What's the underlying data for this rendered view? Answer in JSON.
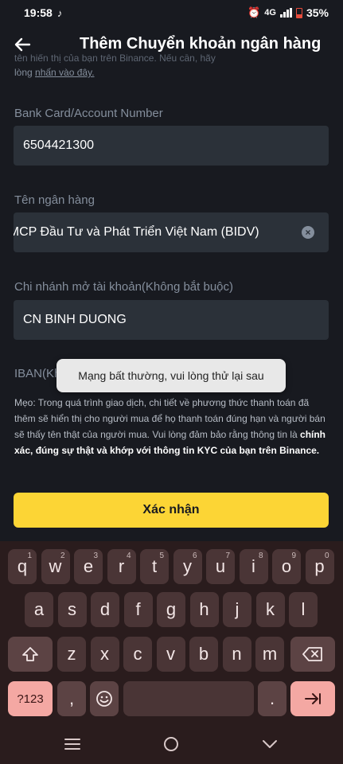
{
  "status": {
    "time": "19:58",
    "network": "4G",
    "battery": "35%"
  },
  "header": {
    "title": "Thêm Chuyển khoản ngân hàng"
  },
  "note_top": {
    "line1": "tên hiển thị của bạn trên Binance. Nếu cần, hãy",
    "line2_prefix": "lòng ",
    "line2_link": "nhấn vào đây."
  },
  "fields": {
    "account": {
      "label": "Bank Card/Account Number",
      "value": "6504421300"
    },
    "bank": {
      "label": "Tên ngân hàng",
      "value": "TMCP Đầu Tư và Phát Triển Việt Nam (BIDV)"
    },
    "branch": {
      "label": "Chi nhánh mở tài khoản(Không bắt buộc)",
      "value": "CN BINH DUONG"
    },
    "iban": {
      "label": "IBAN(Không bắt buộc)"
    }
  },
  "toast": "Mạng bất thường, vui lòng thử lại sau",
  "tip": {
    "text": "Mẹo: Trong quá trình giao dịch, chi tiết về phương thức thanh toán đã thêm sẽ hiển thị cho người mua để họ thanh toán đúng hạn và người bán sẽ thấy tên thật của người mua. Vui lòng đảm bảo rằng thông tin là ",
    "bold": "chính xác, đúng sự thật và khớp với thông tin KYC của bạn trên Binance."
  },
  "confirm_label": "Xác nhận",
  "keyboard": {
    "row1": [
      [
        "q",
        "1"
      ],
      [
        "w",
        "2"
      ],
      [
        "e",
        "3"
      ],
      [
        "r",
        "4"
      ],
      [
        "t",
        "5"
      ],
      [
        "y",
        "6"
      ],
      [
        "u",
        "7"
      ],
      [
        "i",
        "8"
      ],
      [
        "o",
        "9"
      ],
      [
        "p",
        "0"
      ]
    ],
    "row2": [
      "a",
      "s",
      "d",
      "f",
      "g",
      "h",
      "j",
      "k",
      "l"
    ],
    "row3": [
      "z",
      "x",
      "c",
      "v",
      "b",
      "n",
      "m"
    ],
    "symbols_label": "?123",
    "comma": ",",
    "period": "."
  },
  "icons": [
    "tiktok-icon",
    "alarm-icon",
    "signal-icon",
    "battery-icon",
    "back-arrow-icon",
    "clear-icon",
    "shift-icon",
    "backspace-icon",
    "emoji-icon",
    "enter-icon",
    "menu-icon",
    "home-icon",
    "back-chevron-icon"
  ]
}
